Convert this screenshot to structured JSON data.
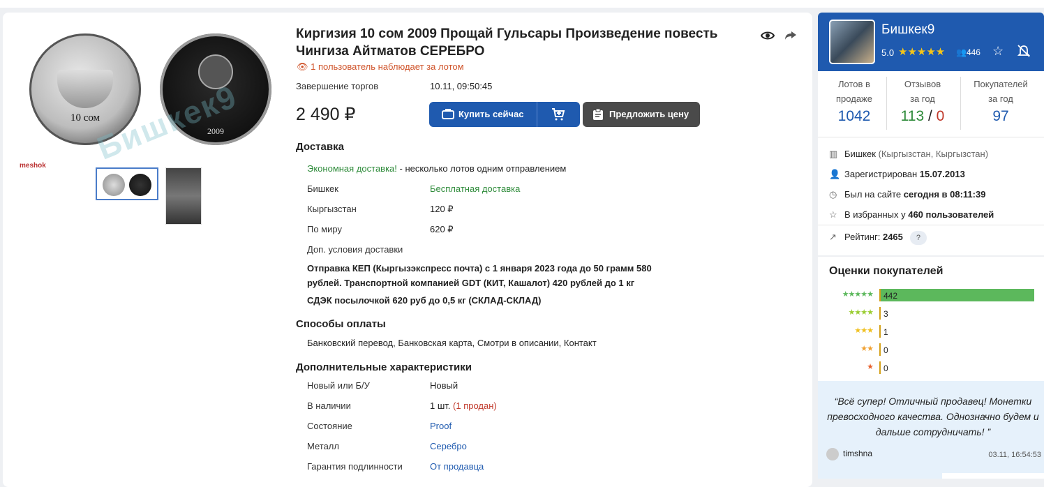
{
  "lot": {
    "title": "Киргизия 10 сом 2009 Прощай Гульсары Произведение повесть Чингиза Айтматов СЕРЕБРО",
    "watchers": "1 пользователь наблюдает за лотом",
    "end_label": "Завершение торгов",
    "end_value": "10.11, 09:50:45",
    "price": "2 490 ₽",
    "buy_label": "Купить сейчас",
    "offer_label": "Предложить цену",
    "image_watermark": "Бишкек9",
    "coin_left_text": "10 сом",
    "coin_right_text": "2009",
    "meshok_logo": "meshok"
  },
  "delivery": {
    "heading": "Доставка",
    "promo": "Экономная доставка!",
    "promo_rest": " - несколько лотов одним отправлением",
    "rows": [
      {
        "label": "Бишкек",
        "value": "Бесплатная доставка"
      },
      {
        "label": "Кыргызстан",
        "value": "120 ₽"
      },
      {
        "label": "По миру",
        "value": "620 ₽"
      }
    ],
    "extra_label": "Доп. условия доставки",
    "extra_text_1": "Отправка КЕП (Кыргызэкспресс почта) с 1 января 2023 года до 50 грамм 580 рублей. Транспортной компанией GDT (КИТ, Кашалот) 420 рублей до 1 кг",
    "extra_text_2": "СДЭК посылочкой 620 руб до 0,5 кг (СКЛАД-СКЛАД)"
  },
  "payment": {
    "heading": "Способы оплаты",
    "text": "Банковский перевод, Банковская карта, Смотри в описании, Контакт"
  },
  "characteristics": {
    "heading": "Дополнительные характеристики",
    "rows": [
      {
        "label": "Новый или Б/У",
        "value": "Новый"
      },
      {
        "label": "В наличии",
        "value": "1 шт.",
        "note": "(1 продан)"
      },
      {
        "label": "Состояние",
        "value": "Proof"
      },
      {
        "label": "Металл",
        "value": "Серебро"
      },
      {
        "label": "Гарантия подлинности",
        "value": "От продавца"
      }
    ]
  },
  "seller": {
    "name": "Бишкек9",
    "rating": "5.0",
    "stars": "★★★★★",
    "reviews_count": "446",
    "stats": [
      {
        "label1": "Лотов в",
        "label2": "продаже",
        "value": "1042"
      },
      {
        "label1": "Отзывов",
        "label2": "за год",
        "value_good": "113",
        "value_sep": " / ",
        "value_bad": "0"
      },
      {
        "label1": "Покупателей",
        "label2": "за год",
        "value": "97"
      }
    ],
    "city": "Бишкек",
    "region": "(Кыргызстан, Кыргызстан)",
    "registered_label": "Зарегистрирован",
    "registered_date": "15.07.2013",
    "online_label": "Был на сайте",
    "online_value": "сегодня в 08:11:39",
    "fav_label": "В избранных у",
    "fav_value": "460 пользователей",
    "rating_label": "Рейтинг:",
    "rating_value": "2465",
    "rating_help": "?"
  },
  "buyer_ratings": {
    "title": "Оценки покупателей",
    "rows": [
      {
        "stars": "★★★★★",
        "count": "442",
        "fraction": 1.0,
        "color": "#5cb85c"
      },
      {
        "stars": "★★★★",
        "count": "3",
        "fraction": 0.007,
        "color": "#9acd32"
      },
      {
        "stars": "★★★",
        "count": "1",
        "fraction": 0.002,
        "color": "#f0c020"
      },
      {
        "stars": "★★",
        "count": "0",
        "fraction": 0,
        "color": "#f0a030"
      },
      {
        "stars": "★",
        "count": "0",
        "fraction": 0,
        "color": "#e8602c"
      }
    ]
  },
  "review": {
    "text": "“Всё супер! Отличный продавец! Монетки превосходного качества. Однозначно будем и дальше сотрудничать! ”",
    "user": "timshna",
    "date": "03.11, 16:54:53"
  }
}
